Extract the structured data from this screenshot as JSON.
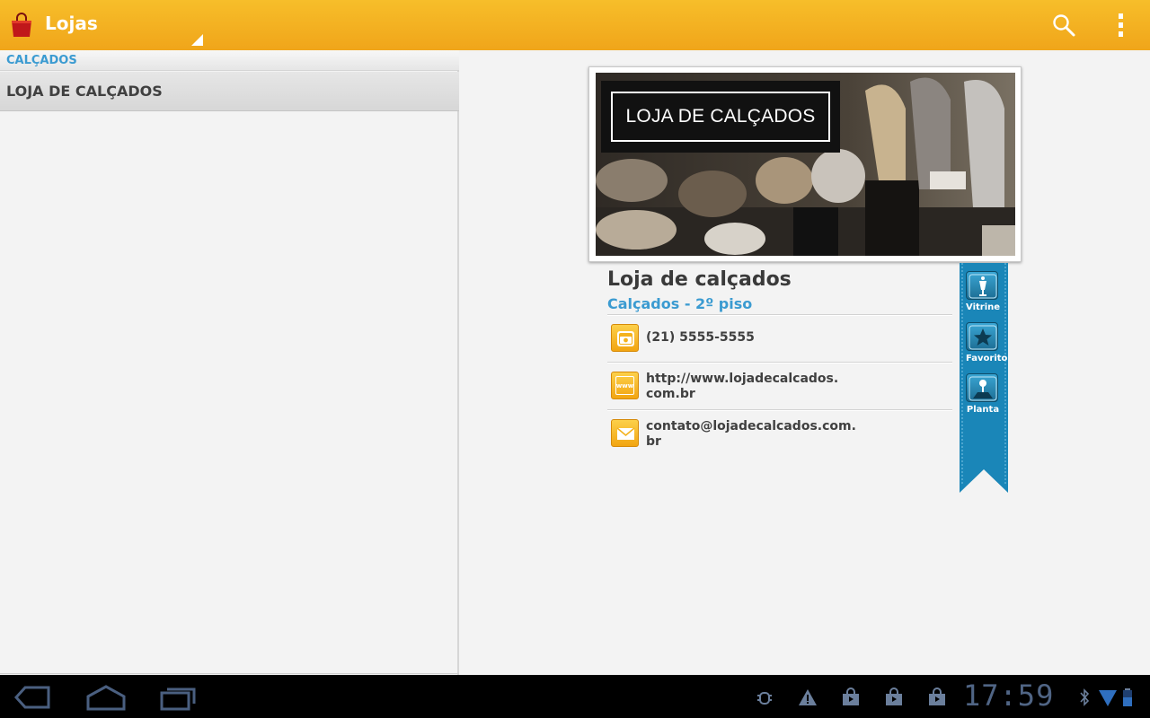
{
  "action_bar": {
    "title": "Lojas",
    "app_icon": "shopping-bag-icon",
    "search_icon": "search-icon",
    "overflow_icon": "overflow-menu-icon"
  },
  "left_panel": {
    "section_header": "CALÇADOS",
    "items": [
      {
        "label": "LOJA DE CALÇADOS"
      }
    ]
  },
  "detail": {
    "photo_banner_text": "LOJA DE CALÇADOS",
    "store_name": "Loja de calçados",
    "category": "Calçados - 2º piso",
    "phone": "(21) 5555-5555",
    "website_line1": "http://www.lojadecalcados.",
    "website_line2": "com.br",
    "email_line1": "contato@lojadecalcados.com.",
    "email_line2": "br",
    "phone_icon_label": "phone-icon",
    "web_icon_text": "www",
    "email_icon_label": "envelope-icon"
  },
  "ribbon": {
    "buttons": [
      {
        "label": "Vitrine",
        "icon": "mannequin-icon"
      },
      {
        "label": "Favorito",
        "icon": "star-icon"
      },
      {
        "label": "Planta",
        "icon": "map-pin-icon"
      }
    ]
  },
  "system_bar": {
    "clock": "17:59",
    "nav": [
      "back-icon",
      "home-icon",
      "recent-apps-icon"
    ],
    "status_icons": [
      "debug-icon",
      "warning-icon",
      "shopping-bag-icon",
      "shopping-bag-icon",
      "shopping-bag-icon",
      "bluetooth-icon",
      "wifi-icon",
      "battery-icon"
    ]
  },
  "colors": {
    "action_bar": "#f0a51a",
    "accent_blue": "#3b9bd1",
    "ribbon_blue": "#1a86b8"
  }
}
